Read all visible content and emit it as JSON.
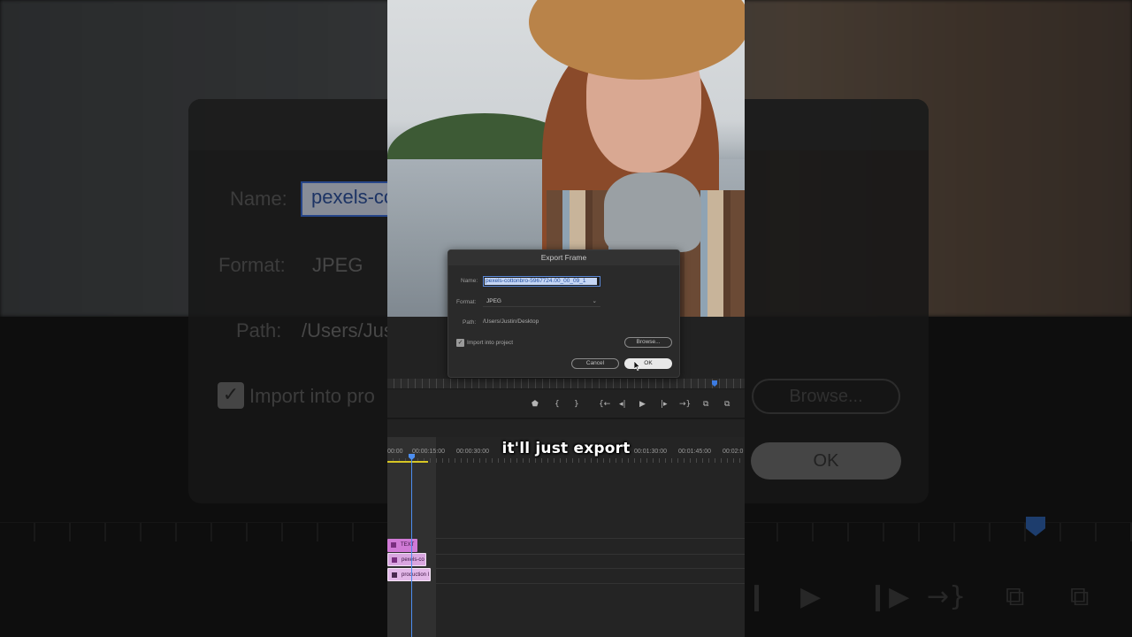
{
  "background": {
    "name_label": "Name:",
    "name_value": "pexels-cc",
    "format_label": "Format:",
    "format_value": "JPEG",
    "path_label": "Path:",
    "path_value": "/Users/Jus",
    "import_label": "Import into pro",
    "browse_label": "Browse...",
    "ok_label": "OK"
  },
  "dialog": {
    "title": "Export Frame",
    "name_label": "Name:",
    "name_value": "pexels-cottonbro-5967724.00_00_09_1",
    "format_label": "Format:",
    "format_value": "JPEG",
    "path_label": "Path:",
    "path_value": "/Users/Justin/Desktop",
    "import_label": "Import into project",
    "import_checked": true,
    "browse_label": "Browse...",
    "cancel_label": "Cancel",
    "ok_label": "OK"
  },
  "transport": {
    "buttons": [
      "marker-icon",
      "mark-in-icon",
      "mark-out-icon",
      "go-to-in-icon",
      "step-back-icon",
      "play-icon",
      "step-forward-icon",
      "go-to-out-icon",
      "lift-icon",
      "extract-icon"
    ]
  },
  "timeline": {
    "timecodes": [
      "00:00",
      "00:00:15:00",
      "00:00:30:00",
      "00:01:30:00",
      "00:01:45:00",
      "00:02:0"
    ],
    "clips": [
      {
        "label": "TEXT",
        "color": "#d07ad6"
      },
      {
        "label": "pexels-co",
        "color": "#d9a6e0"
      },
      {
        "label": "production l",
        "color": "#e3b8e8"
      }
    ]
  },
  "caption": "it'll just export",
  "colors": {
    "accent": "#4c8ef0",
    "selection": "#c5d6f5",
    "clip": "#d07ad6"
  }
}
